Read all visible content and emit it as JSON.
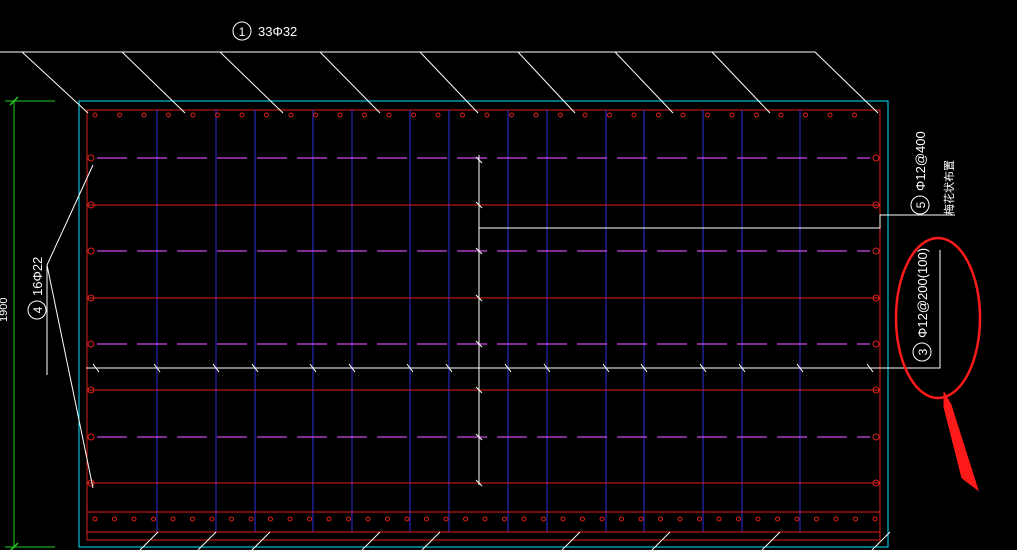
{
  "colors": {
    "background": "#000000",
    "outline": "#00e5ff",
    "horizontal_bars": "#e0201c",
    "vertical_bars": "#3030e0",
    "distribution_bars": "#d048e8",
    "leader_lines": "#ffffff",
    "dimension": "#22cc22",
    "highlight": "#ff1a1a"
  },
  "labels": {
    "rebar_1": {
      "number": "1",
      "text": "33Φ32"
    },
    "rebar_3": {
      "number": "3",
      "text": "Φ12@200(100)"
    },
    "rebar_4": {
      "number": "4",
      "text": "16Φ22"
    },
    "rebar_5": {
      "number": "5",
      "text": "Φ12@400",
      "note": "梅花状布置"
    },
    "dimension": "1900"
  }
}
